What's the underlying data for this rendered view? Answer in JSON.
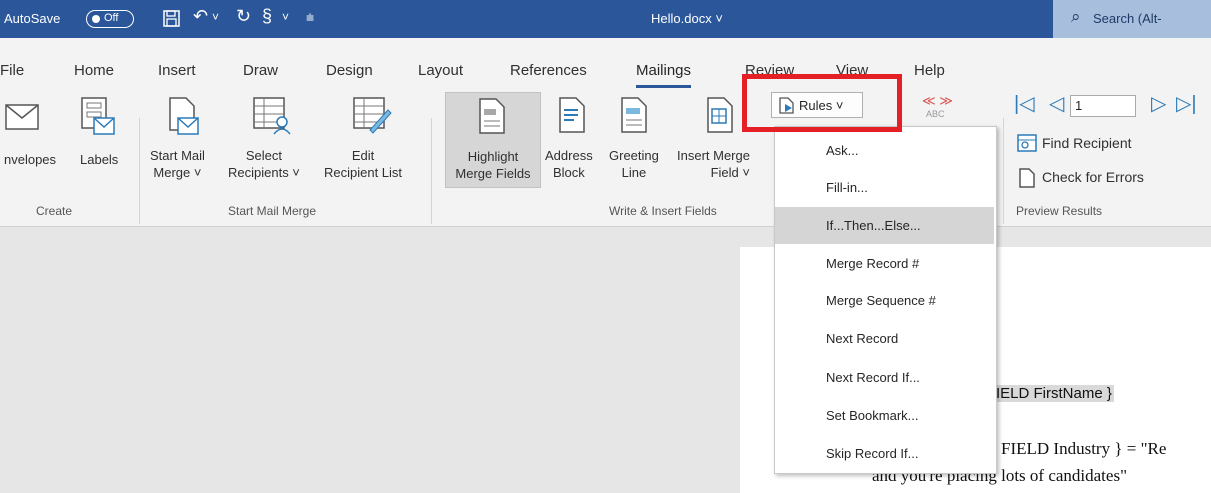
{
  "titlebar": {
    "autosave_label": "AutoSave",
    "autosave_state": "Off",
    "document_name": "Hello.docx",
    "search_placeholder": "Search (Alt-"
  },
  "tabs": [
    "File",
    "Home",
    "Insert",
    "Draw",
    "Design",
    "Layout",
    "References",
    "Mailings",
    "Review",
    "View",
    "Help"
  ],
  "active_tab": "Mailings",
  "ribbon": {
    "create": {
      "envelopes": "nvelopes",
      "labels": "Labels",
      "group": "Create"
    },
    "start": {
      "start_mail_1": "Start Mail",
      "start_mail_2": "Merge ˅",
      "select_1": "Select",
      "select_2": "Recipients ˅",
      "edit_1": "Edit",
      "edit_2": "Recipient List",
      "group": "Start Mail Merge"
    },
    "write": {
      "highlight_1": "Highlight",
      "highlight_2": "Merge Fields",
      "address_1": "Address",
      "address_2": "Block",
      "greeting_1": "Greeting",
      "greeting_2": "Line",
      "insert_1": "Insert Merge",
      "insert_2": "Field ˅",
      "rules": "Rules ˅",
      "group": "Write & Insert Fields"
    },
    "preview": {
      "abc": "ABC",
      "record_value": "1",
      "find": "Find Recipient",
      "check": "Check for Errors",
      "group": "Preview Results"
    }
  },
  "rules_menu": [
    {
      "label": "Ask...",
      "highlighted": false
    },
    {
      "label": "Fill-in...",
      "highlighted": false
    },
    {
      "label": "If...Then...Else...",
      "highlighted": true
    },
    {
      "label": "Merge Record #",
      "highlighted": false
    },
    {
      "label": "Merge Sequence #",
      "highlighted": false
    },
    {
      "label": "Next Record",
      "highlighted": false
    },
    {
      "label": "Next Record If...",
      "highlighted": false
    },
    {
      "label": "Set Bookmark...",
      "highlighted": false
    },
    {
      "label": "Skip Record If...",
      "highlighted": false
    }
  ],
  "document": {
    "field_firstname": "IELD FirstName }",
    "line1": "FIELD Industry } = \"Re",
    "line2": "and you're placing lots of candidates\""
  },
  "colors": {
    "titlebar": "#2b579a",
    "ribbon": "#f3f3f3",
    "highlight_box": "#e41f25",
    "menu_highlight": "#d5d5d5"
  }
}
